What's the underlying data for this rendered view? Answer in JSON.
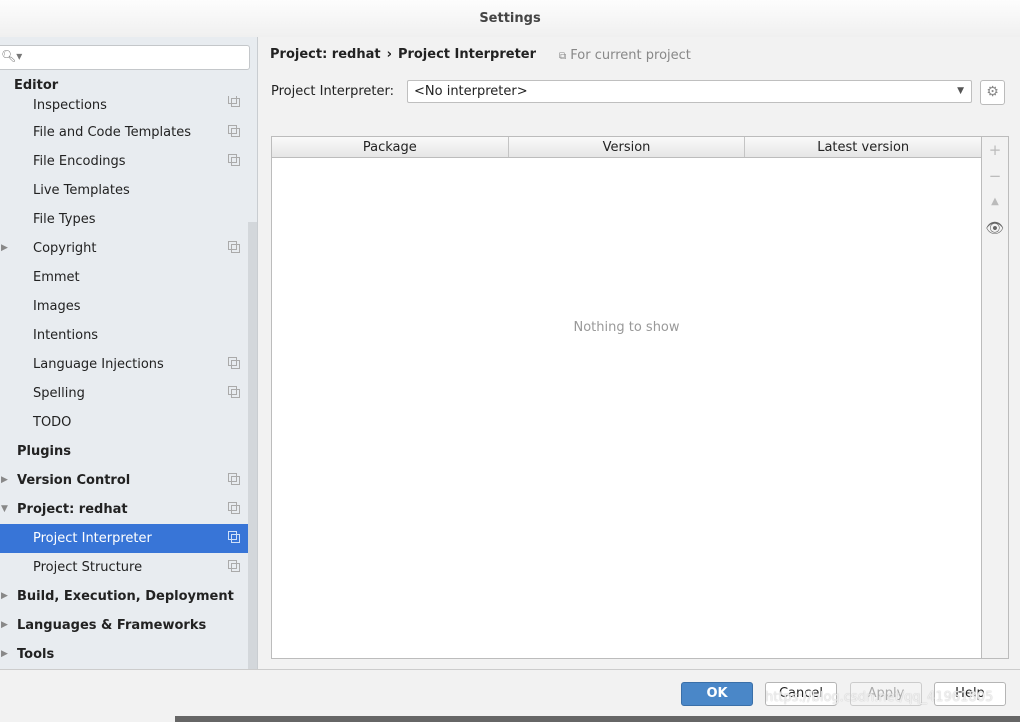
{
  "window": {
    "title": "Settings"
  },
  "sidebar": {
    "search_placeholder": "",
    "items": [
      {
        "label": "Editor",
        "level": "top",
        "arrow": "",
        "copy": false
      },
      {
        "label": "Inspections",
        "level": "child",
        "copy": true
      },
      {
        "label": "File and Code Templates",
        "level": "child",
        "copy": true
      },
      {
        "label": "File Encodings",
        "level": "child",
        "copy": true
      },
      {
        "label": "Live Templates",
        "level": "child",
        "copy": false
      },
      {
        "label": "File Types",
        "level": "child",
        "copy": false
      },
      {
        "label": "Copyright",
        "level": "child",
        "arrow": "▶",
        "copy": true
      },
      {
        "label": "Emmet",
        "level": "child",
        "copy": false
      },
      {
        "label": "Images",
        "level": "child",
        "copy": false
      },
      {
        "label": "Intentions",
        "level": "child",
        "copy": false
      },
      {
        "label": "Language Injections",
        "level": "child",
        "copy": true
      },
      {
        "label": "Spelling",
        "level": "child",
        "copy": true
      },
      {
        "label": "TODO",
        "level": "child",
        "copy": false
      },
      {
        "label": "Plugins",
        "level": "top",
        "copy": false
      },
      {
        "label": "Version Control",
        "level": "top",
        "arrow": "▶",
        "copy": true
      },
      {
        "label": "Project: redhat",
        "level": "top",
        "arrow": "▼",
        "copy": true
      },
      {
        "label": "Project Interpreter",
        "level": "child",
        "copy": true,
        "selected": true
      },
      {
        "label": "Project Structure",
        "level": "child",
        "copy": true
      },
      {
        "label": "Build, Execution, Deployment",
        "level": "top",
        "arrow": "▶",
        "copy": false
      },
      {
        "label": "Languages & Frameworks",
        "level": "top",
        "arrow": "▶",
        "copy": false
      },
      {
        "label": "Tools",
        "level": "top",
        "arrow": "▶",
        "copy": false
      }
    ]
  },
  "main": {
    "breadcrumb": [
      "Project: redhat",
      "›",
      "Project Interpreter"
    ],
    "scope_note": "For current project",
    "interpreter_label": "Project Interpreter:",
    "interpreter_value": "<No interpreter>",
    "table": {
      "columns": [
        "Package",
        "Version",
        "Latest version"
      ],
      "empty_text": "Nothing to show",
      "rows": []
    },
    "tools": [
      "plus-icon",
      "minus-icon",
      "up-icon",
      "eye-icon"
    ]
  },
  "footer": {
    "ok": "OK",
    "cancel": "Cancel",
    "apply": "Apply",
    "help": "Help"
  },
  "watermark": "https://blog.csdn.net/qq_41961805",
  "colors": {
    "selection": "#3875d7",
    "ok_button": "#4a87c8"
  }
}
